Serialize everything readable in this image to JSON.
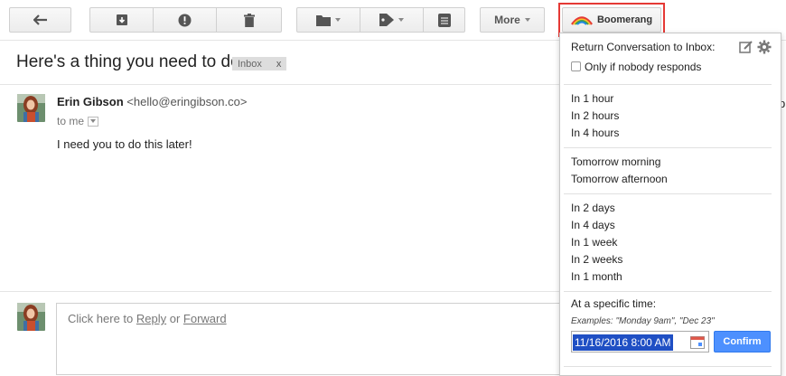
{
  "toolbar": {
    "more_label": "More",
    "boomerang_label": "Boomerang",
    "icons": [
      "back-arrow-icon",
      "archive-icon",
      "report-spam-icon",
      "trash-icon",
      "folder-icon",
      "tag-icon",
      "layers-icon"
    ]
  },
  "email": {
    "subject": "Here's a thing you need to do",
    "label": "Inbox",
    "label_close": "x",
    "sender_name": "Erin Gibson",
    "sender_email": "<hello@eringibson.co>",
    "recipient": "to me",
    "body": "I need you to do this later!",
    "edge_fragment": "p"
  },
  "reply": {
    "prefix": "Click here to ",
    "reply_link": "Reply",
    "middle": " or ",
    "forward_link": "Forward"
  },
  "boomerang_panel": {
    "title": "Return Conversation to Inbox:",
    "checkbox_label": "Only if nobody responds",
    "group1": [
      "In 1 hour",
      "In 2 hours",
      "In 4 hours"
    ],
    "group2": [
      "Tomorrow morning",
      "Tomorrow afternoon"
    ],
    "group3": [
      "In 2 days",
      "In 4 days",
      "In 1 week",
      "In 2 weeks",
      "In 1 month"
    ],
    "specific_label": "At a specific time:",
    "examples": "Examples: \"Monday 9am\", \"Dec 23\"",
    "date_value": "11/16/2016 8:00 AM",
    "confirm_label": "Confirm"
  },
  "colors": {
    "highlight_frame": "#e53935",
    "confirm_button": "#4d90fe",
    "selection": "#1f4fc4"
  }
}
